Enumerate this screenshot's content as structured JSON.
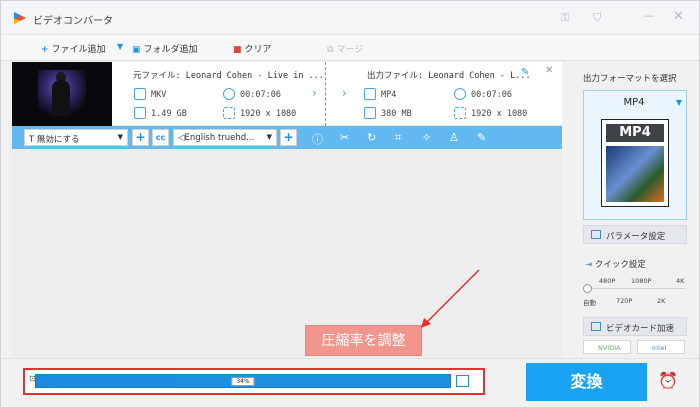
{
  "window": {
    "title": "ビデオコンバータ",
    "controls": [
      "key-icon",
      "cart-icon",
      "minimize-icon",
      "close-icon"
    ]
  },
  "toolbar": {
    "add_file": "ファイル追加",
    "add_folder": "フォルダ追加",
    "clear": "クリア",
    "merge": "マージ"
  },
  "file_item": {
    "source_label": "元ファイル: Leonard Cohen - Live in ...",
    "source": {
      "format": "MKV",
      "duration": "00:07:06",
      "size": "1.49 GB",
      "resolution": "1920 x 1080"
    },
    "output_label": "出力ファイル: Leonard Cohen - L...",
    "output": {
      "format": "MP4",
      "duration": "00:07:06",
      "size": "380 MB",
      "resolution": "1920 x 1080"
    }
  },
  "edit_bar": {
    "subtitle_select": "無効にする",
    "audio_select": "English truehd...",
    "cc_label": "cc"
  },
  "right_panel": {
    "title": "出力フォーマットを選択",
    "format": "MP4",
    "format_icon_text": "MP4",
    "param_button": "パラメータ設定",
    "quick_title": "クイック設定",
    "ticks_top": [
      "480P",
      "1080P",
      "4K"
    ],
    "ticks_bottom": [
      "自動",
      "720P",
      "2K"
    ],
    "gpu_button": "ビデオカード加速",
    "badges": [
      "NVIDIA",
      "Intel"
    ]
  },
  "bottom": {
    "compression_percent": "34%",
    "compression_value": 0.34,
    "convert_label": "変換"
  },
  "annotation": {
    "callout": "圧縮率を調整",
    "color": "#e33030"
  }
}
